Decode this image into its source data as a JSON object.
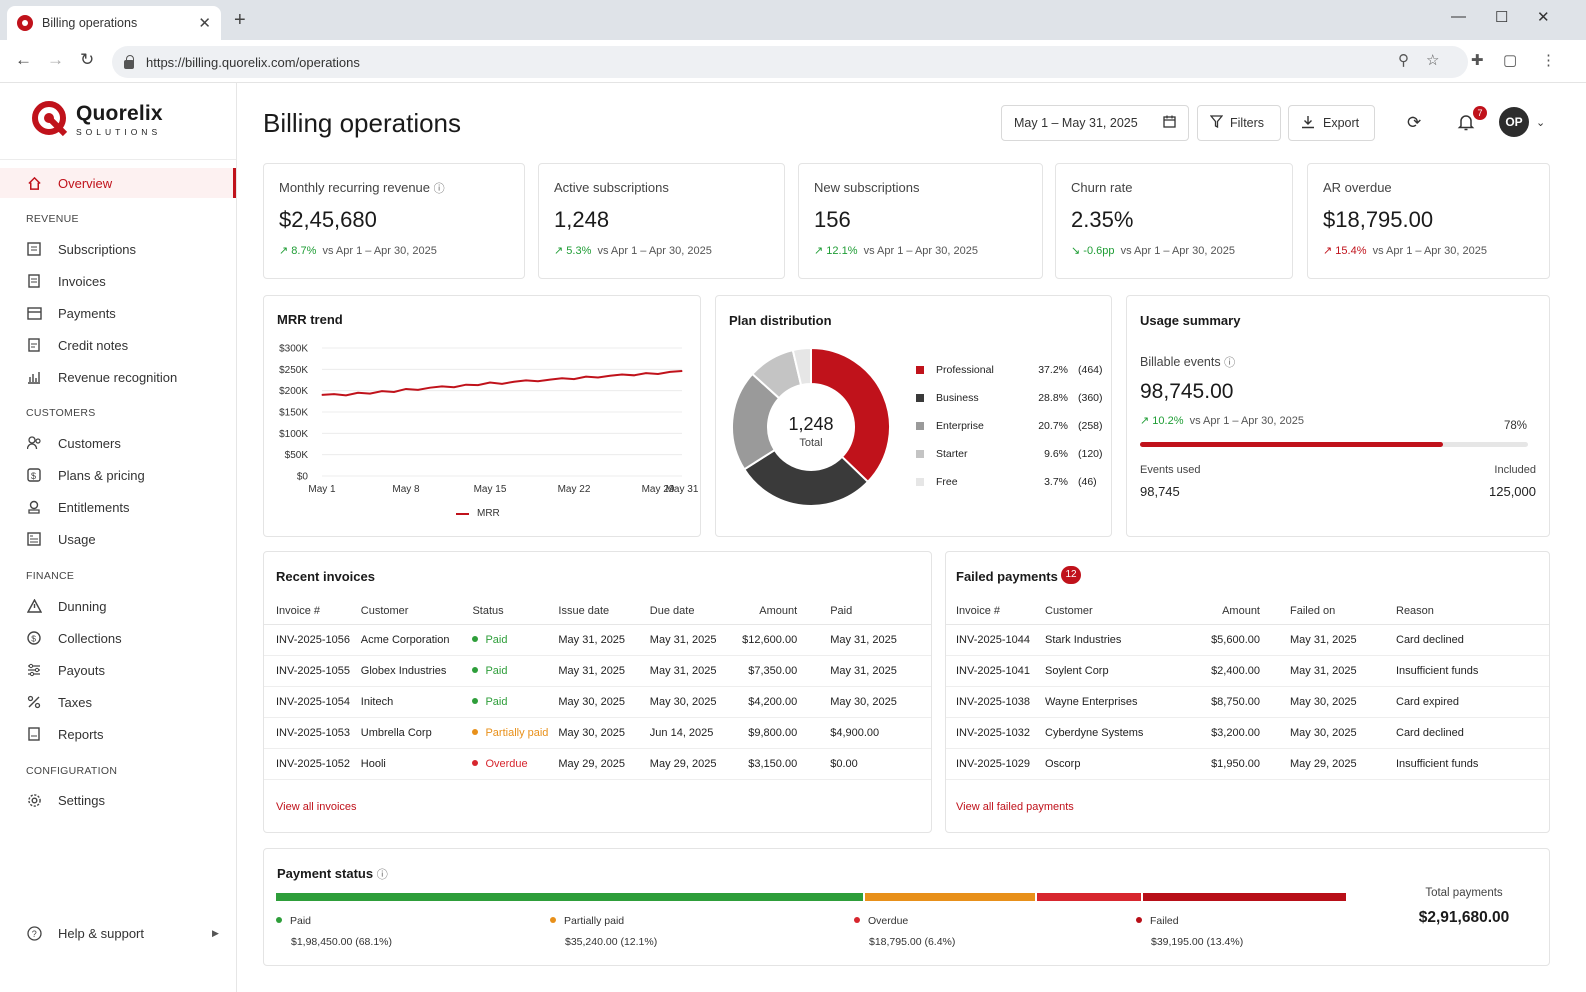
{
  "browser": {
    "tab_title": "Billing operations",
    "url": "https://billing.quorelix.com/operations"
  },
  "brand": {
    "name": "Quorelix",
    "tagline": "SOLUTIONS",
    "accent": "#c0121b"
  },
  "sidebar": {
    "overview": "Overview",
    "sections": {
      "revenue": "REVENUE",
      "customers": "CUSTOMERS",
      "finance": "FINANCE",
      "configuration": "CONFIGURATION"
    },
    "revenue_items": [
      "Subscriptions",
      "Invoices",
      "Payments",
      "Credit notes",
      "Revenue recognition"
    ],
    "customer_items": [
      "Customers",
      "Plans & pricing",
      "Entitlements",
      "Usage"
    ],
    "finance_items": [
      "Dunning",
      "Collections",
      "Payouts",
      "Taxes",
      "Reports"
    ],
    "config_items": [
      "Settings"
    ],
    "help": "Help & support"
  },
  "header": {
    "title": "Billing operations",
    "date_range": "May 1 – May 31, 2025",
    "filters": "Filters",
    "export": "Export",
    "notif_count": "7",
    "avatar": "OP"
  },
  "kpis": [
    {
      "label": "Monthly recurring revenue",
      "value": "$2,45,680",
      "change": "8.7%",
      "compare": "vs Apr 1 – Apr 30, 2025"
    },
    {
      "label": "Active subscriptions",
      "value": "1,248",
      "change": "5.3%",
      "compare": "vs Apr 1 – Apr 30, 2025"
    },
    {
      "label": "New subscriptions",
      "value": "156",
      "change": "12.1%",
      "compare": "vs Apr 1 – Apr 30, 2025"
    },
    {
      "label": "Churn rate",
      "value": "2.35%",
      "change": "-0.6pp",
      "compare": "vs Apr 1 – Apr 30, 2025"
    },
    {
      "label": "AR overdue",
      "value": "$18,795.00",
      "change": "15.4%",
      "compare": "vs Apr 1 – Apr 30, 2025"
    }
  ],
  "mrr": {
    "title": "MRR trend",
    "legend": "MRR"
  },
  "plan": {
    "title": "Plan distribution",
    "total": "1,248",
    "total_label": "Total",
    "items": [
      {
        "name": "Professional",
        "pct": "37.2%",
        "count": "(464)",
        "color": "#c0121b"
      },
      {
        "name": "Business",
        "pct": "28.8%",
        "count": "(360)",
        "color": "#3a3a3a"
      },
      {
        "name": "Enterprise",
        "pct": "20.7%",
        "count": "(258)",
        "color": "#9a9a9a"
      },
      {
        "name": "Starter",
        "pct": "9.6%",
        "count": "(120)",
        "color": "#c4c4c4"
      },
      {
        "name": "Free",
        "pct": "3.7%",
        "count": "(46)",
        "color": "#e6e6e6"
      }
    ]
  },
  "usage": {
    "title": "Usage summary",
    "label": "Billable events",
    "value": "98,745.00",
    "change": "10.2%",
    "compare": "vs Apr 1 – Apr 30, 2025",
    "pct_label": "78%",
    "pct": 0.78,
    "used_label": "Events used",
    "used": "98,745",
    "incl_label": "Included",
    "incl": "125,000"
  },
  "invoices": {
    "title": "Recent invoices",
    "link": "View all invoices",
    "headers": [
      "Invoice #",
      "Customer",
      "Status",
      "Issue date",
      "Due date",
      "Amount",
      "Paid"
    ],
    "rows": [
      [
        "INV-2025-1056",
        "Acme Corporation",
        "Paid",
        "May 31, 2025",
        "May 31, 2025",
        "$12,600.00",
        "May 31, 2025"
      ],
      [
        "INV-2025-1055",
        "Globex Industries",
        "Paid",
        "May 31, 2025",
        "May 31, 2025",
        "$7,350.00",
        "May 31, 2025"
      ],
      [
        "INV-2025-1054",
        "Initech",
        "Paid",
        "May 30, 2025",
        "May 30, 2025",
        "$4,200.00",
        "May 30, 2025"
      ],
      [
        "INV-2025-1053",
        "Umbrella Corp",
        "Partially paid",
        "May 30, 2025",
        "Jun 14, 2025",
        "$9,800.00",
        "$4,900.00"
      ],
      [
        "INV-2025-1052",
        "Hooli",
        "Overdue",
        "May 29, 2025",
        "May 29, 2025",
        "$3,150.00",
        "$0.00"
      ]
    ]
  },
  "failed": {
    "title": "Failed payments",
    "count": "12",
    "link": "View all failed payments",
    "headers": [
      "Invoice #",
      "Customer",
      "Amount",
      "Failed on",
      "Reason"
    ],
    "rows": [
      [
        "INV-2025-1044",
        "Stark Industries",
        "$5,600.00",
        "May 31, 2025",
        "Card declined"
      ],
      [
        "INV-2025-1041",
        "Soylent Corp",
        "$2,400.00",
        "May 31, 2025",
        "Insufficient funds"
      ],
      [
        "INV-2025-1038",
        "Wayne Enterprises",
        "$8,750.00",
        "May 30, 2025",
        "Card expired"
      ],
      [
        "INV-2025-1032",
        "Cyberdyne Systems",
        "$3,200.00",
        "May 30, 2025",
        "Card declined"
      ],
      [
        "INV-2025-1029",
        "Oscorp",
        "$1,950.00",
        "May 29, 2025",
        "Insufficient funds"
      ]
    ]
  },
  "payment_status": {
    "title": "Payment status",
    "total_label": "Total payments",
    "total": "$2,91,680.00",
    "items": [
      {
        "name": "Paid",
        "value": "$1,98,450.00 (68.1%)",
        "share": 0.551,
        "color": "#2e9e3a"
      },
      {
        "name": "Partially paid",
        "value": "$35,240.00 (12.1%)",
        "share": 0.159,
        "color": "#e8901a"
      },
      {
        "name": "Overdue",
        "value": "$18,795.00 (6.4%)",
        "share": 0.098,
        "color": "#d7262e"
      },
      {
        "name": "Failed",
        "value": "$39,195.00 (13.4%)",
        "share": 0.19,
        "color": "#b80f18"
      }
    ]
  },
  "chart_data": {
    "type": "line",
    "title": "MRR trend",
    "x": [
      "May 1",
      "May 2",
      "May 3",
      "May 4",
      "May 5",
      "May 6",
      "May 7",
      "May 8",
      "May 9",
      "May 10",
      "May 11",
      "May 12",
      "May 13",
      "May 14",
      "May 15",
      "May 16",
      "May 17",
      "May 18",
      "May 19",
      "May 20",
      "May 21",
      "May 22",
      "May 23",
      "May 24",
      "May 25",
      "May 26",
      "May 27",
      "May 28",
      "May 29",
      "May 30",
      "May 31"
    ],
    "x_ticks": [
      "May 1",
      "May 8",
      "May 15",
      "May 22",
      "May 29",
      "May 31"
    ],
    "series": [
      {
        "name": "MRR",
        "values": [
          190000,
          192000,
          189000,
          195000,
          193000,
          199000,
          197000,
          204000,
          202000,
          207000,
          210000,
          208000,
          214000,
          213000,
          219000,
          216000,
          221000,
          224000,
          222000,
          226000,
          229000,
          227000,
          233000,
          231000,
          235000,
          238000,
          236000,
          241000,
          239000,
          244000,
          246000
        ],
        "color": "#c0121b"
      }
    ],
    "ylim": [
      0,
      300000
    ],
    "y_ticks": [
      "$0",
      "$50K",
      "$100K",
      "$150K",
      "$200K",
      "$250K",
      "$300K"
    ],
    "grid": true,
    "legend": "bottom"
  }
}
